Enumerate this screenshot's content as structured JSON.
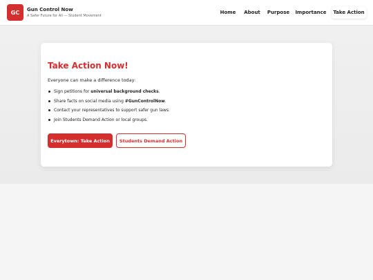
{
  "brand": {
    "logo_text": "GC",
    "title": "Gun Control Now",
    "subtitle": "A Safer Future for All — Student Movement"
  },
  "nav": {
    "home": "Home",
    "about": "About",
    "purpose": "Purpose",
    "importance": "Importance",
    "take_action": "Take Action",
    "active": "Take Action"
  },
  "card": {
    "title": "Take Action Now!",
    "intro": "Everyone can make a difference today:",
    "items": [
      {
        "pre": "Sign petitions for ",
        "bold": "universal background checks",
        "post": "."
      },
      {
        "pre": "Share facts on social media using ",
        "bold": "#GunControlNow",
        "post": "."
      },
      {
        "pre": "Contact your representatives to support safer gun laws.",
        "bold": "",
        "post": ""
      },
      {
        "pre": "Join Students Demand Action or local groups.",
        "bold": "",
        "post": ""
      }
    ],
    "primary_button": "Everytown: Take Action",
    "secondary_button": "Students Demand Action"
  },
  "colors": {
    "accent": "#d42f2f",
    "background": "#f4f4f4"
  }
}
